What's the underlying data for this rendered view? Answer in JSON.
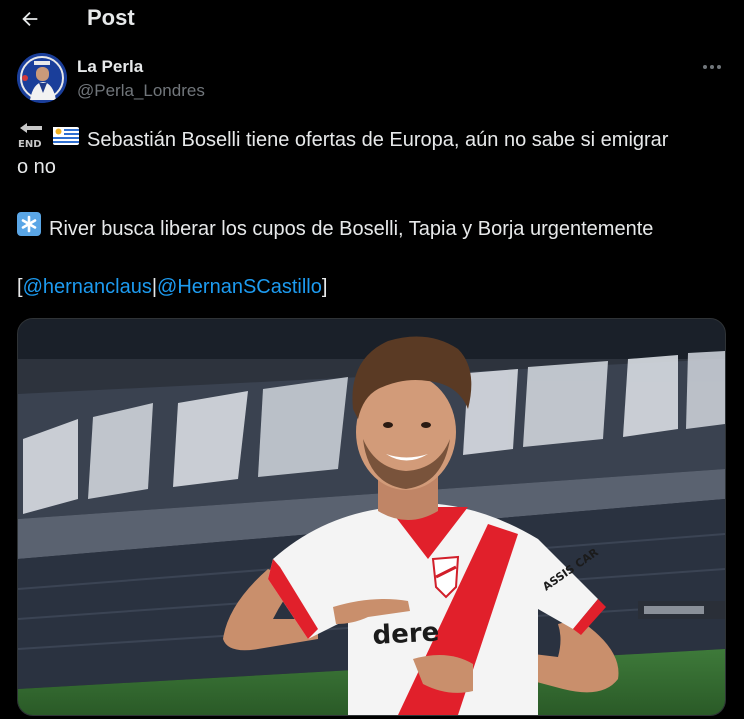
{
  "header": {
    "back_icon": "arrow-left-icon",
    "title": "Post"
  },
  "author": {
    "display_name": "La Perla",
    "handle": "@Perla_Londres",
    "avatar_icon": "avatar-image",
    "more_icon": "more-horizontal-icon"
  },
  "post": {
    "line1_emoji_1": "end-arrow-emoji",
    "line1_emoji_2": "uruguay-flag-emoji",
    "line1_text": "Sebastián Boselli tiene ofertas de Europa, aún no sabe si emigrar",
    "line2_text": "o no",
    "line3_emoji": "asterisk-emoji",
    "line3_text": "River busca liberar los cupos de Boselli, Tapia y Borja urgentemente",
    "bracket_open": "[",
    "mention_1": "@hernanclaus",
    "separator": "|",
    "mention_2": "@HernanSCastillo",
    "bracket_close": "]"
  },
  "media": {
    "kind": "photo",
    "jersey_sponsor": "dere",
    "sleeve_text": "ASSIS CAR"
  },
  "colors": {
    "background": "#000000",
    "text": "#e7e9ea",
    "secondary": "#71767b",
    "link": "#1d9bf0"
  }
}
